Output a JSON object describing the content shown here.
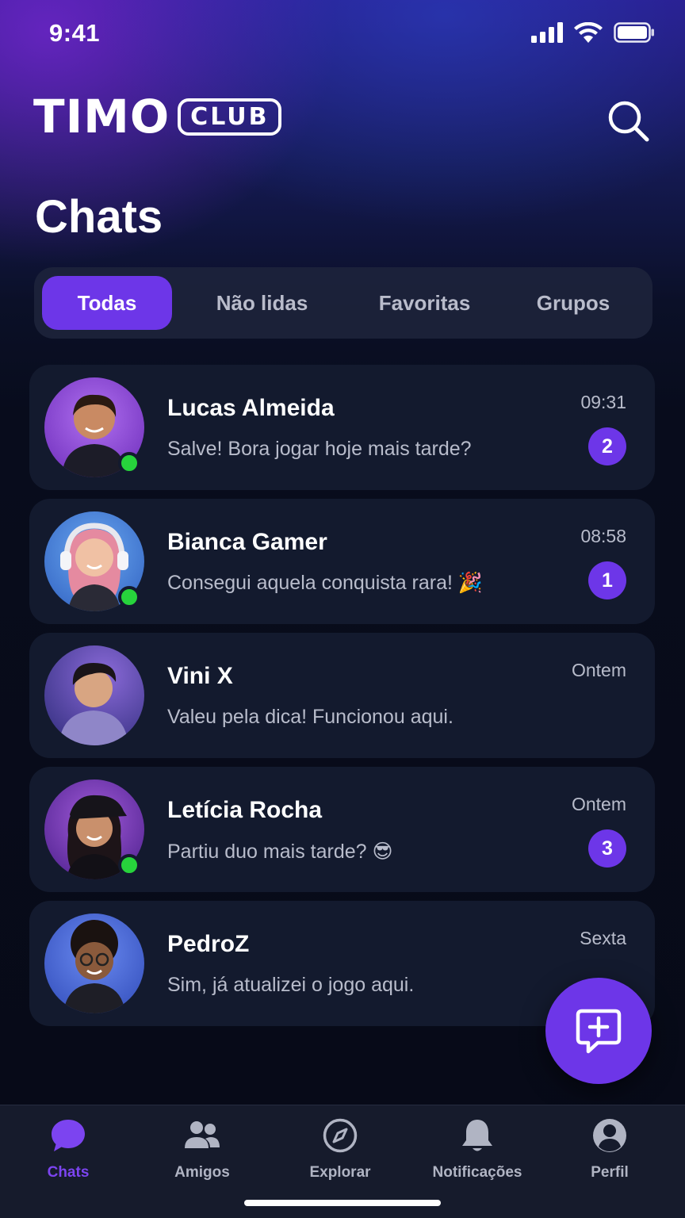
{
  "status_bar": {
    "time": "9:41"
  },
  "header": {
    "logo_word": "TIMO",
    "logo_badge": "CLUB",
    "title": "Chats"
  },
  "tabs": [
    {
      "label": "Todas",
      "active": true
    },
    {
      "label": "Não lidas",
      "active": false
    },
    {
      "label": "Favoritas",
      "active": false
    },
    {
      "label": "Grupos",
      "active": false
    }
  ],
  "chats": [
    {
      "name": "Lucas Almeida",
      "preview": "Salve! Bora jogar hoje mais tarde?",
      "time": "09:31",
      "unread": "2",
      "online": true,
      "avatar_bg": "#8a3fd0"
    },
    {
      "name": "Bianca Gamer",
      "preview": "Consegui aquela conquista rara! 🎉",
      "time": "08:58",
      "unread": "1",
      "online": true,
      "avatar_bg": "#3a7ad8"
    },
    {
      "name": "Vini X",
      "preview": "Valeu pela dica! Funcionou aqui.",
      "time": "Ontem",
      "unread": null,
      "online": false,
      "avatar_bg": "#4a3a9a"
    },
    {
      "name": "Letícia Rocha",
      "preview": "Partiu duo mais tarde? 😎",
      "time": "Ontem",
      "unread": "3",
      "online": true,
      "avatar_bg": "#7a2fb0"
    },
    {
      "name": "PedroZ",
      "preview": "Sim, já atualizei o jogo aqui.",
      "time": "Sexta",
      "unread": null,
      "online": false,
      "avatar_bg": "#3b5fc0"
    }
  ],
  "nav": [
    {
      "label": "Chats",
      "icon": "chat-bubble-icon",
      "active": true
    },
    {
      "label": "Amigos",
      "icon": "friends-icon",
      "active": false
    },
    {
      "label": "Explorar",
      "icon": "compass-icon",
      "active": false
    },
    {
      "label": "Notificações",
      "icon": "bell-icon",
      "active": false
    },
    {
      "label": "Perfil",
      "icon": "profile-icon",
      "active": false
    }
  ],
  "colors": {
    "accent": "#6d36e8",
    "online": "#27d33c",
    "card": "#131a2e"
  }
}
